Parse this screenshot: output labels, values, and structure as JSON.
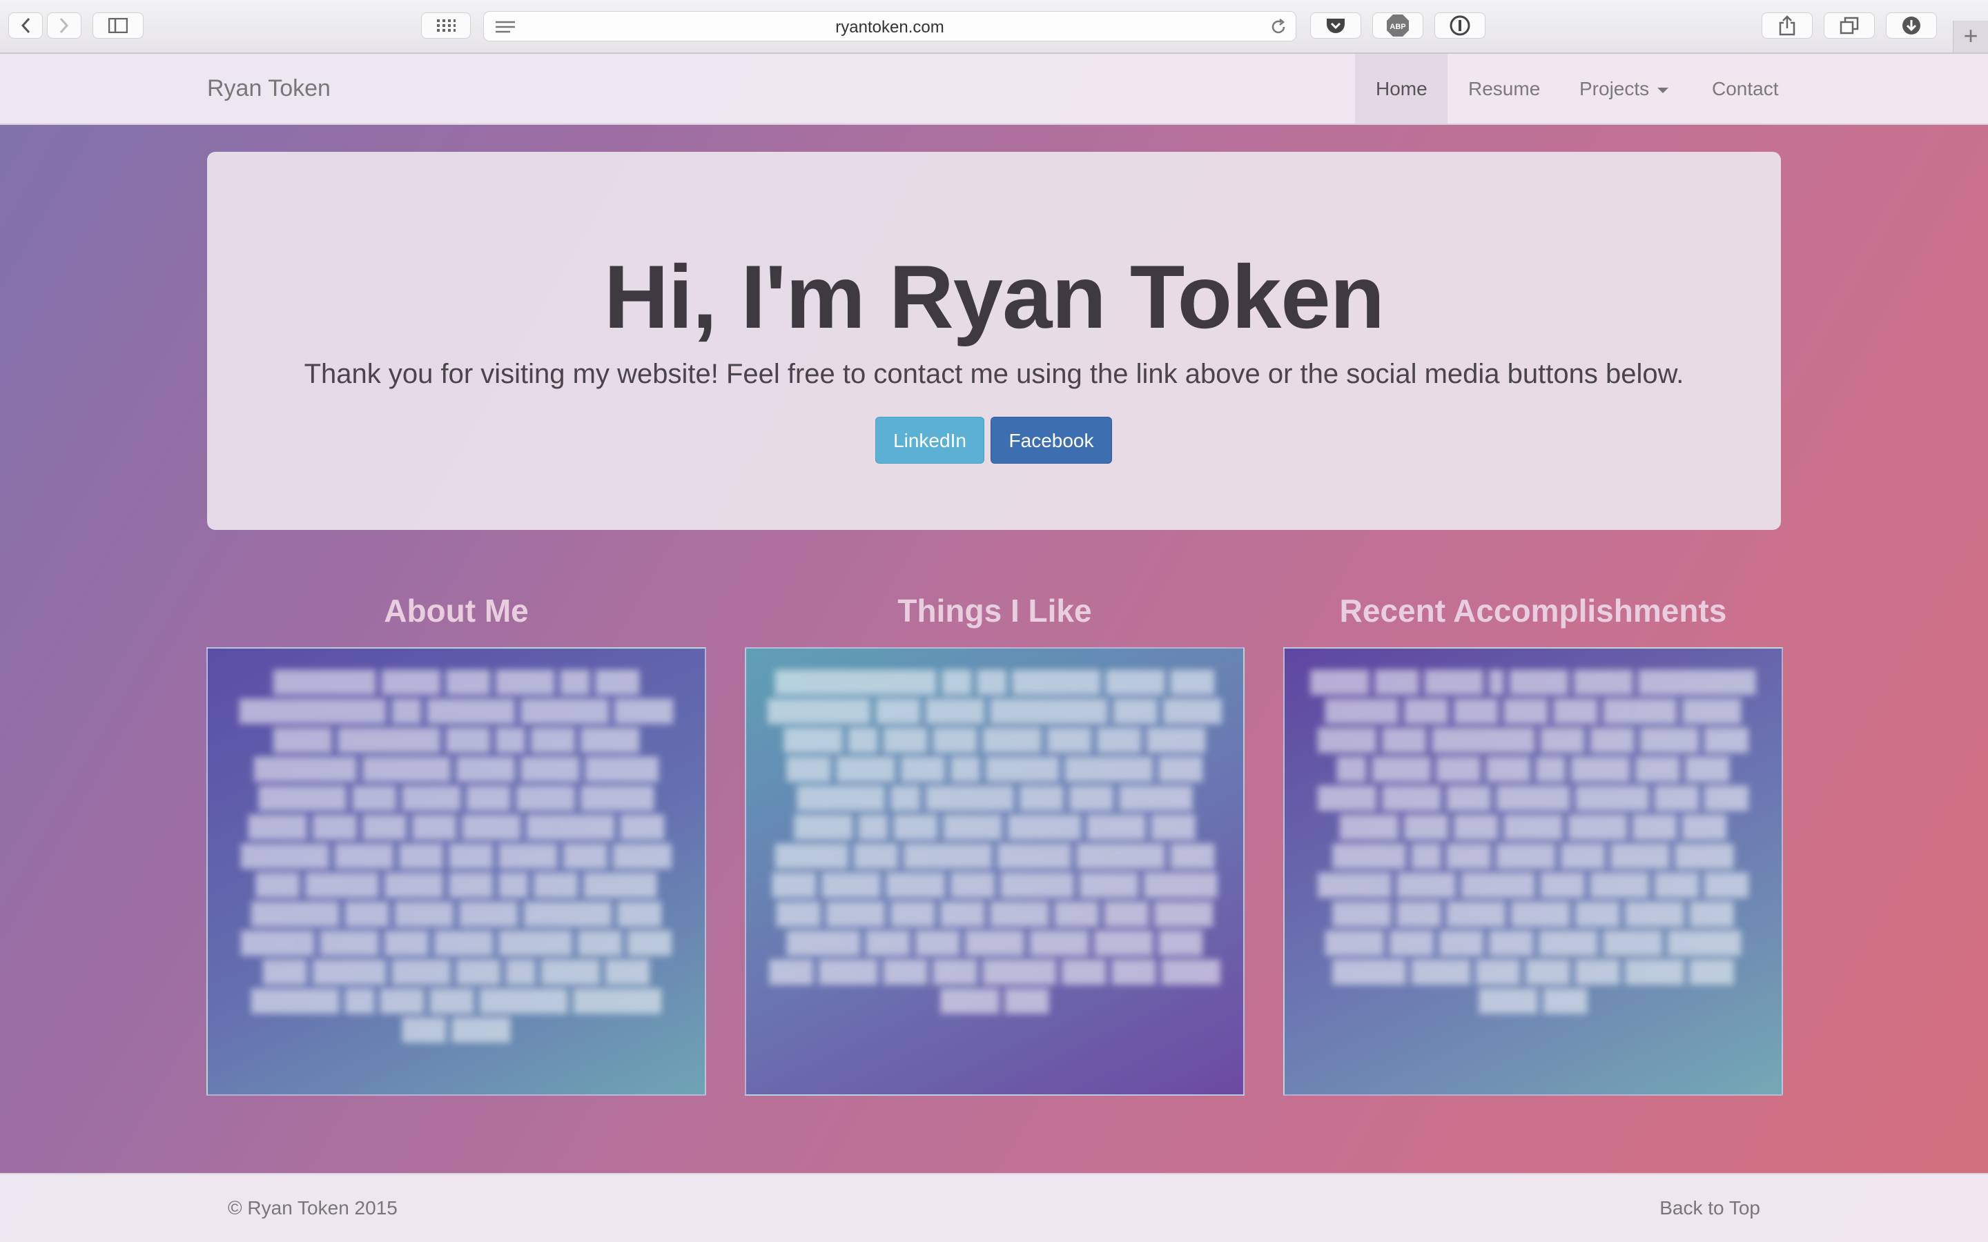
{
  "browser": {
    "url": "ryantoken.com",
    "icons": [
      "back-icon",
      "forward-icon",
      "sidebar-icon",
      "top-sites-icon",
      "reader-icon",
      "reload-icon",
      "pocket-icon",
      "adblock-icon",
      "onepassword-icon",
      "share-icon",
      "tabs-icon",
      "downloads-icon",
      "new-tab-icon"
    ],
    "adblock_label": "ABP",
    "new_tab_label": "+"
  },
  "nav": {
    "brand": "Ryan Token",
    "items": [
      {
        "label": "Home",
        "active": true
      },
      {
        "label": "Resume",
        "active": false
      },
      {
        "label": "Projects",
        "active": false,
        "dropdown": true
      },
      {
        "label": "Contact",
        "active": false
      }
    ]
  },
  "hero": {
    "title": "Hi, I'm Ryan Token",
    "subtitle": "Thank you for visiting my website! Feel free to contact me using the link above or the social media buttons below.",
    "buttons": {
      "linkedin": "LinkedIn",
      "facebook": "Facebook"
    }
  },
  "sections": [
    {
      "title": "About Me"
    },
    {
      "title": "Things I Like"
    },
    {
      "title": "Recent Accomplishments"
    }
  ],
  "footer": {
    "copyright": "© Ryan Token 2015",
    "back_to_top": "Back to Top"
  },
  "colors": {
    "linkedin": "#5bb0d4",
    "facebook": "#3d6fb0",
    "nav_active_bg": "#e3d9e4"
  }
}
